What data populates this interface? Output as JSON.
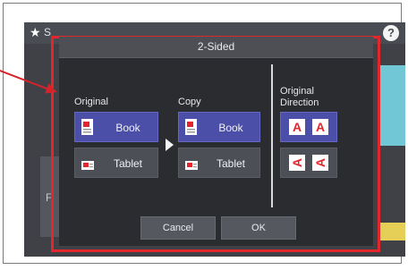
{
  "background": {
    "title_fragment": "S",
    "left_text_1": "",
    "left_text_2": "F"
  },
  "dialog": {
    "title": "2-Sided",
    "original": {
      "label": "Original",
      "options": [
        {
          "label": "Book",
          "selected": true
        },
        {
          "label": "Tablet",
          "selected": false
        }
      ]
    },
    "copy": {
      "label": "Copy",
      "options": [
        {
          "label": "Book",
          "selected": true
        },
        {
          "label": "Tablet",
          "selected": false
        }
      ]
    },
    "original_direction": {
      "label_line1": "Original",
      "label_line2": "Direction",
      "options": [
        {
          "glyph": "A",
          "selected": true
        },
        {
          "glyph": "A",
          "selected": false
        }
      ]
    },
    "buttons": {
      "cancel": "Cancel",
      "ok": "OK"
    }
  },
  "colors": {
    "accent_selected": "#4b4fa8",
    "highlight_red": "#e2262b",
    "dialog_bg": "#2b2c30"
  }
}
